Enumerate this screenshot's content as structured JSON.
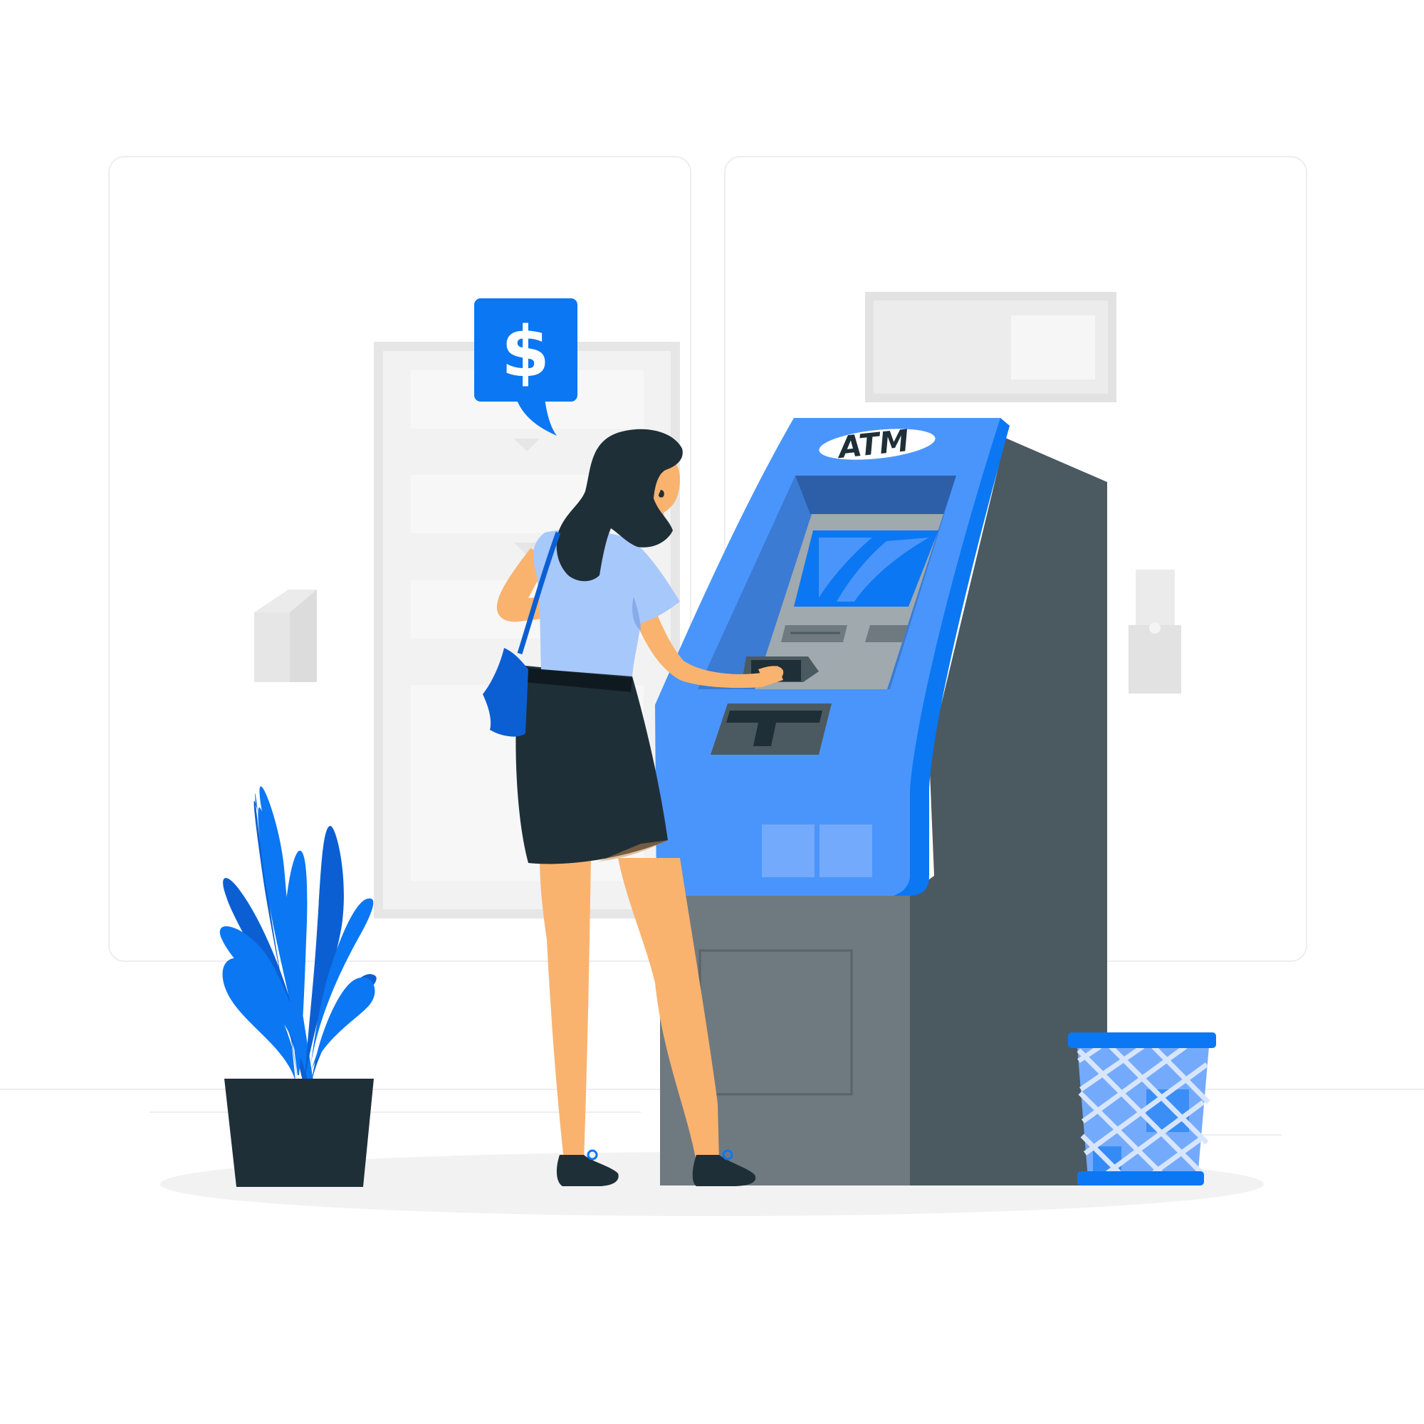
{
  "atm": {
    "label": "ATM"
  },
  "speech_bubble": {
    "symbol": "$",
    "icon": "dollar-icon"
  },
  "colors": {
    "accent_blue": "#0b77f3",
    "light_blue": "#4a95fb",
    "pale_blue": "#a7c8fb",
    "dark_navy": "#1f2f38",
    "atm_dark_side": "#4b5a61",
    "atm_base": "#6f7a80",
    "skin": "#f9b36f",
    "background_panel": "#f4f4f4",
    "floor_shadow": "#f2f2f2"
  }
}
